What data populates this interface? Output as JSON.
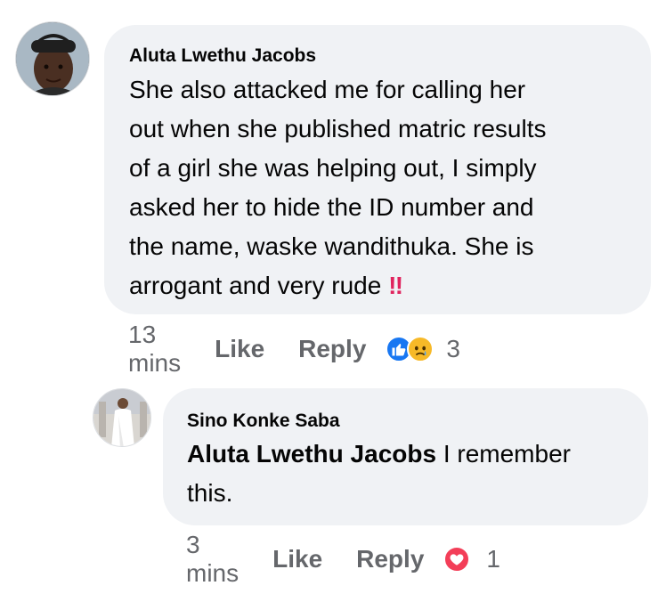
{
  "comments": [
    {
      "author": "Aluta Lwethu Jacobs",
      "text_lines": [
        "She also attacked me for calling her",
        "out when she published matric results",
        "of a girl she was helping out, I simply",
        "asked her to hide the ID number and",
        "the name, waske wandithuka. She is",
        "arrogant and very rude"
      ],
      "emoji": "‼",
      "time": "13 mins",
      "like_label": "Like",
      "reply_label": "Reply",
      "reaction_count": "3",
      "reactions": [
        "like-icon",
        "sad-icon"
      ]
    },
    {
      "author": "Sino Konke Saba",
      "mention": "Aluta Lwethu Jacobs",
      "text_line1": " I remember",
      "text_line2": "this.",
      "time": "3 mins",
      "like_label": "Like",
      "reply_label": "Reply",
      "reaction_count": "1",
      "reactions": [
        "love-icon"
      ]
    }
  ],
  "colors": {
    "bubble": "#f0f2f5",
    "like_blue": "#1877f2",
    "love_red": "#f33e58",
    "sad_yellow": "#f7b928",
    "meta_gray": "#65676b"
  }
}
